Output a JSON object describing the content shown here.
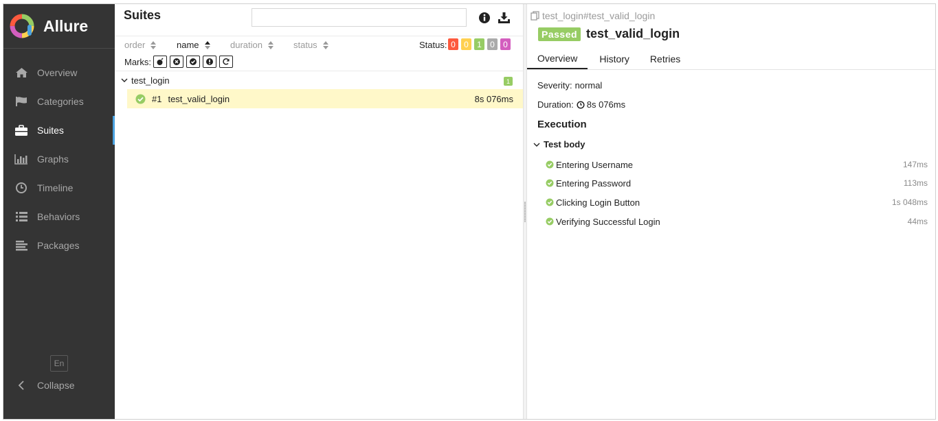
{
  "sidebar": {
    "brand": "Allure",
    "items": [
      {
        "label": "Overview",
        "icon": "home-icon"
      },
      {
        "label": "Categories",
        "icon": "flag-icon"
      },
      {
        "label": "Suites",
        "icon": "briefcase-icon",
        "active": true
      },
      {
        "label": "Graphs",
        "icon": "bar-chart-icon"
      },
      {
        "label": "Timeline",
        "icon": "clock-icon"
      },
      {
        "label": "Behaviors",
        "icon": "list-icon"
      },
      {
        "label": "Packages",
        "icon": "align-left-icon"
      }
    ],
    "language": "En",
    "collapse_label": "Collapse"
  },
  "suites_pane": {
    "title": "Suites",
    "search": {
      "value": "",
      "placeholder": ""
    },
    "sort": {
      "order": "order",
      "name": "name",
      "duration": "duration",
      "status": "status",
      "active": "name"
    },
    "status_label": "Status:",
    "status_counts": [
      {
        "name": "failed",
        "count": "0",
        "color": "#fd5a3e"
      },
      {
        "name": "broken",
        "count": "0",
        "color": "#ffd050"
      },
      {
        "name": "passed",
        "count": "1",
        "color": "#97cc64"
      },
      {
        "name": "skipped",
        "count": "0",
        "color": "#aaaaaa"
      },
      {
        "name": "unknown",
        "count": "0",
        "color": "#d35ebe"
      }
    ],
    "marks_label": "Marks:",
    "marks": [
      "flaky-icon",
      "new-failed-icon",
      "new-passed-icon",
      "new-broken-icon",
      "retries-icon"
    ],
    "group": {
      "name": "test_login",
      "count": "1"
    },
    "tests": [
      {
        "number": "#1",
        "name": "test_valid_login",
        "duration": "8s 076ms",
        "status": "passed"
      }
    ]
  },
  "detail": {
    "breadcrumb": "test_login#test_valid_login",
    "status_badge": "Passed",
    "title": "test_valid_login",
    "tabs": [
      "Overview",
      "History",
      "Retries"
    ],
    "active_tab": "Overview",
    "severity_label": "Severity:",
    "severity_value": "normal",
    "duration_label": "Duration:",
    "duration_value": "8s 076ms",
    "execution_title": "Execution",
    "test_body_label": "Test body",
    "steps": [
      {
        "name": "Entering Username",
        "duration": "147ms"
      },
      {
        "name": "Entering Password",
        "duration": "113ms"
      },
      {
        "name": "Clicking Login Button",
        "duration": "1s 048ms"
      },
      {
        "name": "Verifying Successful Login",
        "duration": "44ms"
      }
    ]
  },
  "colors": {
    "sidebar_bg": "#343434",
    "accent": "#4aa2e0",
    "passed": "#97cc64",
    "selected_row": "#fff8c9"
  }
}
